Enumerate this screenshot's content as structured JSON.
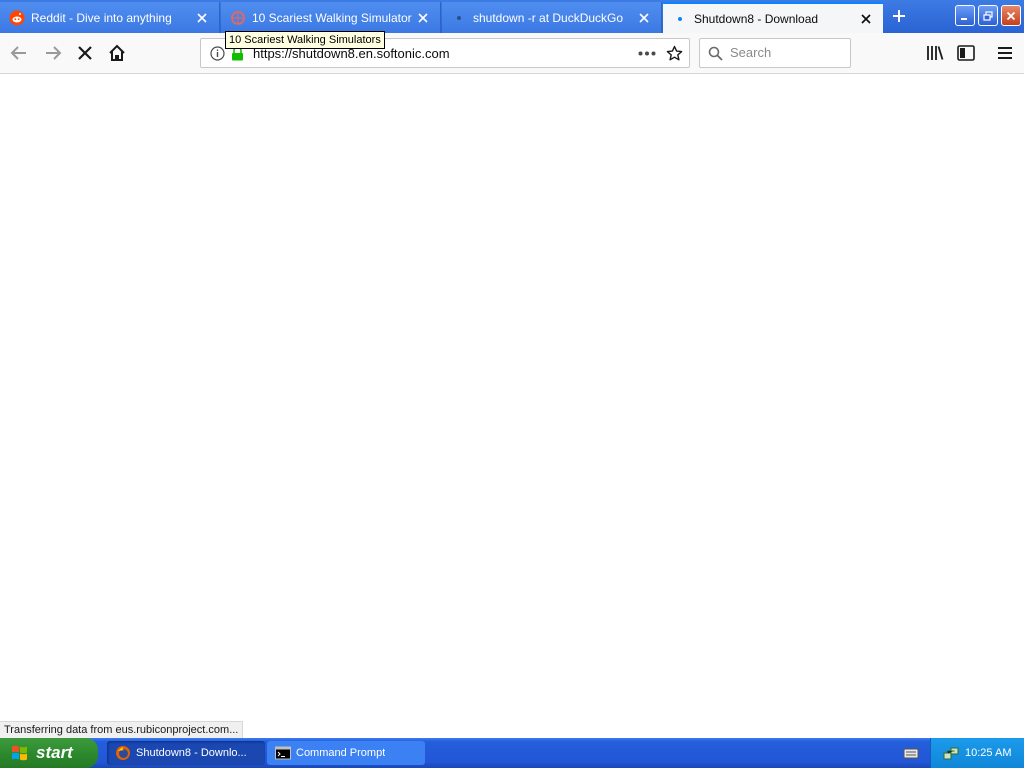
{
  "browser": {
    "tabs": [
      {
        "title": "Reddit - Dive into anything",
        "icon": "reddit-icon"
      },
      {
        "title": "10 Scariest Walking Simulators",
        "icon": "site-icon"
      },
      {
        "title": "shutdown -r at DuckDuckGo",
        "icon": "duckduckgo-icon"
      },
      {
        "title": "Shutdown8 - Download",
        "icon": "loading-icon",
        "active": true
      }
    ],
    "tooltip": "10 Scariest Walking Simulators",
    "url": "https://shutdown8.en.softonic.com",
    "search_placeholder": "Search",
    "status_text": "Transferring data from eus.rubiconproject.com..."
  },
  "taskbar": {
    "start_label": "start",
    "tasks": [
      {
        "label": "Shutdown8 - Downlo...",
        "active": true,
        "icon": "firefox-icon"
      },
      {
        "label": "Command Prompt",
        "active": false,
        "icon": "command-prompt-icon"
      }
    ],
    "clock": "10:25 AM"
  },
  "colors": {
    "accent": "#0a84ff",
    "secure_lock": "#12bc00",
    "xp_taskbar": "#245edb",
    "xp_start": "#2e8a2e"
  }
}
